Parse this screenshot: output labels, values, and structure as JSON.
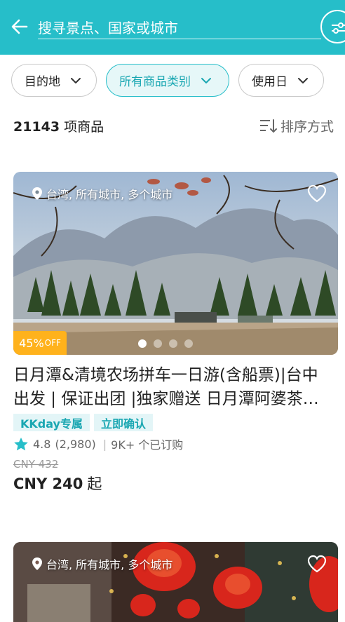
{
  "header": {
    "search_placeholder": "搜寻景点、国家或城市"
  },
  "filters": [
    {
      "label": "目的地"
    },
    {
      "label": "所有商品类别"
    },
    {
      "label": "使用日"
    }
  ],
  "results": {
    "count": "21143",
    "count_unit": "项商品",
    "sort_label": "排序方式"
  },
  "products": [
    {
      "location": "台湾, 所有城市, 多个城市",
      "discount": "45%",
      "discount_suffix": "OFF",
      "title": "日月潭&清境农场拼车一日游(含船票)|台中出发 | 保证出团 |独家赠送 日月潭阿婆茶…",
      "tags": [
        "KKday专属",
        "立即确认"
      ],
      "rating": "4.8",
      "reviews": "(2,980)",
      "orders": "9K+ 个已订购",
      "old_price": "CNY 432",
      "price": "CNY 240",
      "price_suffix": "起",
      "carousel_total": 4,
      "carousel_active": 1
    },
    {
      "location": "台湾, 所有城市, 多个城市"
    }
  ],
  "colors": {
    "brand": "#26bec9",
    "discount": "#ffb21c",
    "tag_bg": "#e3f5f7",
    "star": "#26bec9"
  },
  "icons": [
    "back-arrow-icon",
    "filter-sliders-icon",
    "chevron-down-icon",
    "sort-icon",
    "location-pin-icon",
    "heart-icon",
    "star-icon"
  ]
}
